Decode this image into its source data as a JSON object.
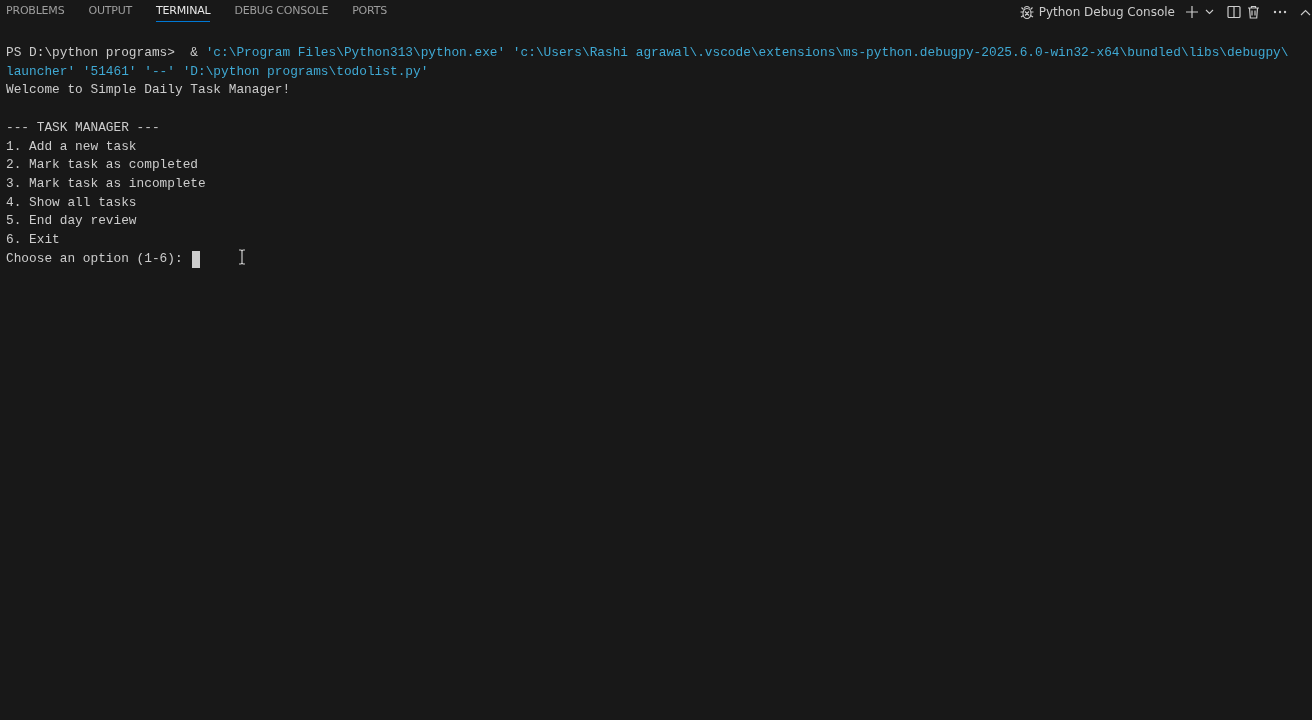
{
  "panel_tabs": [
    {
      "label": "PROBLEMS",
      "selected": false
    },
    {
      "label": "OUTPUT",
      "selected": false
    },
    {
      "label": "TERMINAL",
      "selected": true
    },
    {
      "label": "DEBUG CONSOLE",
      "selected": false
    },
    {
      "label": "PORTS",
      "selected": false
    }
  ],
  "terminal_name": "Python Debug Console",
  "terminal": {
    "lines": [
      {
        "kind": "text",
        "segments": [
          {
            "text": "PS D:\\python programs>  & ",
            "kind": "plain"
          },
          {
            "text": "'c:\\Program Files\\Python313\\python.exe' 'c:\\Users\\Rashi agrawal\\.vscode\\extensions\\ms-python.debugpy-2025.6.0-win32-x64\\bundled\\libs\\debugpy\\",
            "kind": "string"
          }
        ]
      },
      {
        "kind": "text",
        "segments": [
          {
            "text": "launcher' '51461' '--' 'D:\\python programs\\todolist.py'",
            "kind": "string"
          }
        ]
      },
      {
        "kind": "text",
        "segments": [
          {
            "text": "Welcome to Simple Daily Task Manager!",
            "kind": "plain"
          }
        ]
      },
      {
        "kind": "blank"
      },
      {
        "kind": "text",
        "segments": [
          {
            "text": "--- TASK MANAGER ---",
            "kind": "plain"
          }
        ]
      },
      {
        "kind": "text",
        "segments": [
          {
            "text": "1. Add a new task",
            "kind": "plain"
          }
        ]
      },
      {
        "kind": "text",
        "segments": [
          {
            "text": "2. Mark task as completed",
            "kind": "plain"
          }
        ]
      },
      {
        "kind": "text",
        "segments": [
          {
            "text": "3. Mark task as incomplete",
            "kind": "plain"
          }
        ]
      },
      {
        "kind": "text",
        "segments": [
          {
            "text": "4. Show all tasks",
            "kind": "plain"
          }
        ]
      },
      {
        "kind": "text",
        "segments": [
          {
            "text": "5. End day review",
            "kind": "plain"
          }
        ]
      },
      {
        "kind": "text",
        "segments": [
          {
            "text": "6. Exit",
            "kind": "plain"
          }
        ]
      },
      {
        "kind": "text",
        "segments": [
          {
            "text": "Choose an option (1-6): ",
            "kind": "plain"
          }
        ],
        "cursor": true
      }
    ]
  }
}
